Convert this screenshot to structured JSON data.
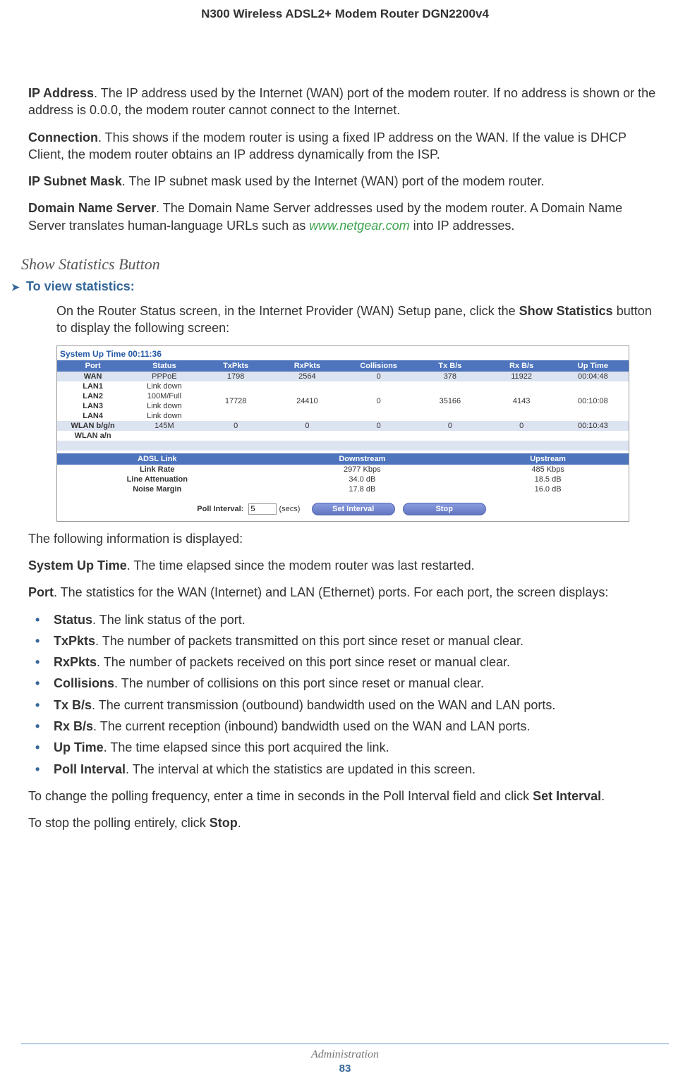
{
  "header": {
    "title": "N300 Wireless ADSL2+ Modem Router DGN2200v4"
  },
  "definitions": [
    {
      "term": "IP Address",
      "text": ". The IP address used by the Internet (WAN) port of the modem router. If no address is shown or the address is 0.0.0, the modem router cannot connect to the Internet."
    },
    {
      "term": "Connection",
      "text": ". This shows if the modem router is using a fixed IP address on the WAN. If the value is DHCP Client, the modem router obtains an IP address dynamically from the ISP."
    },
    {
      "term": "IP Subnet Mask",
      "text": ". The IP subnet mask used by the Internet (WAN) port of the modem router."
    },
    {
      "term": "Domain Name Server",
      "pre": ". The Domain Name Server addresses used by the modem router. A Domain Name Server translates human-language URLs such as ",
      "link": "www.netgear.com",
      "post": " into IP addresses."
    }
  ],
  "section": {
    "title": "Show Statistics Button"
  },
  "procedure": {
    "marker": "➤",
    "title": "To view statistics:",
    "intro_pre": "On the Router Status screen, in the Internet Provider (WAN) Setup pane, click the ",
    "intro_bold": "Show Statistics",
    "intro_post": " button to display the following screen:"
  },
  "figure": {
    "sys_uptime_label": "System Up Time",
    "sys_uptime_value": "00:11:36",
    "stats_headers": [
      "Port",
      "Status",
      "TxPkts",
      "RxPkts",
      "Collisions",
      "Tx B/s",
      "Rx B/s",
      "Up Time"
    ],
    "stats_rows": [
      {
        "port": "WAN",
        "status": "PPPoE",
        "tx": "1798",
        "rx": "2564",
        "col": "0",
        "txbs": "378",
        "rxbs": "11922",
        "up": "00:04:48"
      },
      {
        "port": "LAN1",
        "status": "Link down",
        "tx": "",
        "rx": "",
        "col": "",
        "txbs": "",
        "rxbs": "",
        "up": ""
      },
      {
        "port": "LAN2",
        "status": "100M/Full",
        "tx": "17728",
        "rx": "24410",
        "col": "0",
        "txbs": "35166",
        "rxbs": "4143",
        "up": "00:10:08"
      },
      {
        "port": "LAN3",
        "status": "Link down",
        "tx": "",
        "rx": "",
        "col": "",
        "txbs": "",
        "rxbs": "",
        "up": ""
      },
      {
        "port": "LAN4",
        "status": "Link down",
        "tx": "",
        "rx": "",
        "col": "",
        "txbs": "",
        "rxbs": "",
        "up": ""
      },
      {
        "port": "WLAN b/g/n",
        "status": "145M",
        "tx": "0",
        "rx": "0",
        "col": "0",
        "txbs": "0",
        "rxbs": "0",
        "up": "00:10:43"
      },
      {
        "port": "WLAN a/n",
        "status": "",
        "tx": "",
        "rx": "",
        "col": "",
        "txbs": "",
        "rxbs": "",
        "up": ""
      }
    ],
    "adsl_headers": [
      "ADSL Link",
      "Downstream",
      "Upstream"
    ],
    "adsl_rows": [
      {
        "label": "Link Rate",
        "down": "2977 Kbps",
        "up": "485 Kbps"
      },
      {
        "label": "Line Attenuation",
        "down": "34.0 dB",
        "up": "18.5 dB"
      },
      {
        "label": "Noise Margin",
        "down": "17.8 dB",
        "up": "16.0 dB"
      }
    ],
    "poll_label": "Poll Interval:",
    "poll_value": "5",
    "poll_unit": "(secs)",
    "btn_set": "Set Interval",
    "btn_stop": "Stop"
  },
  "after_figure": "The following information is displayed:",
  "sys_uptime_def": {
    "term": "System Up Time",
    "text": ". The time elapsed since the modem router was last restarted."
  },
  "port_def": {
    "term": "Port",
    "text": ". The statistics for the WAN (Internet) and LAN (Ethernet) ports. For each port, the screen displays:"
  },
  "bullets": [
    {
      "term": "Status",
      "text": ". The link status of the port."
    },
    {
      "term": "TxPkts",
      "text": ". The number of packets transmitted on this port since reset or manual clear."
    },
    {
      "term": "RxPkts",
      "text": ". The number of packets received on this port since reset or manual clear."
    },
    {
      "term": "Collisions",
      "text": ". The number of collisions on this port since reset or manual clear."
    },
    {
      "term": "Tx B/s",
      "text": ". The current transmission (outbound) bandwidth used on the WAN and LAN ports."
    },
    {
      "term": "Rx B/s",
      "text": ". The current reception (inbound) bandwidth used on the WAN and LAN ports."
    },
    {
      "term": "Up Time",
      "text": ". The time elapsed since this port acquired the link."
    },
    {
      "term": "Poll Interval",
      "text": ". The interval at which the statistics are updated in this screen."
    }
  ],
  "set_interval_pre": "To change the polling frequency, enter a time in seconds in the Poll Interval field and click ",
  "set_interval_bold": "Set Interval",
  "set_interval_post": ".",
  "stop_pre": "To stop the polling entirely, click ",
  "stop_bold": "Stop",
  "stop_post": ".",
  "footer": {
    "chapter": "Administration",
    "page": "83"
  }
}
